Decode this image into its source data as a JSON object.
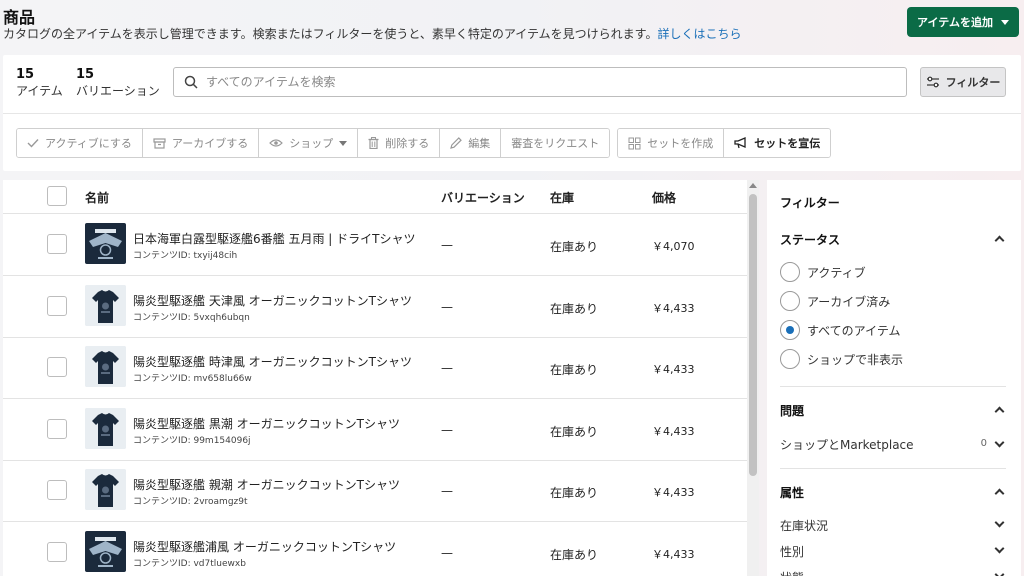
{
  "header": {
    "title": "商品",
    "description": "カタログの全アイテムを表示し管理できます。検索またはフィルターを使うと、素早く特定のアイテムを見つけられます。",
    "learn_more": "詳しくはこちら",
    "add_button": "アイテムを追加"
  },
  "stats": {
    "items_count": "15",
    "items_label": "アイテム",
    "variations_count": "15",
    "variations_label": "バリエーション"
  },
  "search": {
    "placeholder": "すべてのアイテムを検索"
  },
  "filter_button": "フィルター",
  "actions": {
    "activate": "アクティブにする",
    "archive": "アーカイブする",
    "shop": "ショップ",
    "delete": "削除する",
    "edit": "編集",
    "request_review": "審査をリクエスト",
    "create_set": "セットを作成",
    "promote_set": "セットを宣伝"
  },
  "table": {
    "columns": {
      "name": "名前",
      "variations": "バリエーション",
      "stock": "在庫",
      "price": "価格"
    },
    "rows": [
      {
        "name": "日本海軍白露型駆逐艦6番艦 五月雨 | ドライTシャツ",
        "content_id": "コンテンツID: txyij48cih",
        "variations": "—",
        "stock": "在庫あり",
        "price": "￥4,070",
        "thumb": "emblem"
      },
      {
        "name": "陽炎型駆逐艦 天津風 オーガニックコットンTシャツ",
        "content_id": "コンテンツID: 5vxqh6ubqn",
        "variations": "—",
        "stock": "在庫あり",
        "price": "￥4,433",
        "thumb": "tshirt"
      },
      {
        "name": "陽炎型駆逐艦 時津風 オーガニックコットンTシャツ",
        "content_id": "コンテンツID: mv658lu66w",
        "variations": "—",
        "stock": "在庫あり",
        "price": "￥4,433",
        "thumb": "tshirt"
      },
      {
        "name": "陽炎型駆逐艦 黒潮 オーガニックコットンTシャツ",
        "content_id": "コンテンツID: 99m154096j",
        "variations": "—",
        "stock": "在庫あり",
        "price": "￥4,433",
        "thumb": "tshirt"
      },
      {
        "name": "陽炎型駆逐艦 親潮 オーガニックコットンTシャツ",
        "content_id": "コンテンツID: 2vroamgz9t",
        "variations": "—",
        "stock": "在庫あり",
        "price": "￥4,433",
        "thumb": "tshirt"
      },
      {
        "name": "陽炎型駆逐艦浦風 オーガニックコットンTシャツ",
        "content_id": "コンテンツID: vd7tluewxb",
        "variations": "—",
        "stock": "在庫あり",
        "price": "￥4,433",
        "thumb": "emblem"
      }
    ]
  },
  "filters": {
    "title": "フィルター",
    "status": {
      "label": "ステータス",
      "options": [
        "アクティブ",
        "アーカイブ済み",
        "すべてのアイテム",
        "ショップで非表示"
      ],
      "selected_index": 2
    },
    "issues": {
      "label": "問題",
      "item": "ショップとMarketplace",
      "count": "0"
    },
    "attributes": {
      "label": "属性",
      "items": [
        "在庫状況",
        "性別",
        "状態"
      ]
    }
  },
  "colors": {
    "primary": "#0b6b46",
    "link": "#1a6fb8",
    "thumb_dark": "#1b2a3c"
  }
}
